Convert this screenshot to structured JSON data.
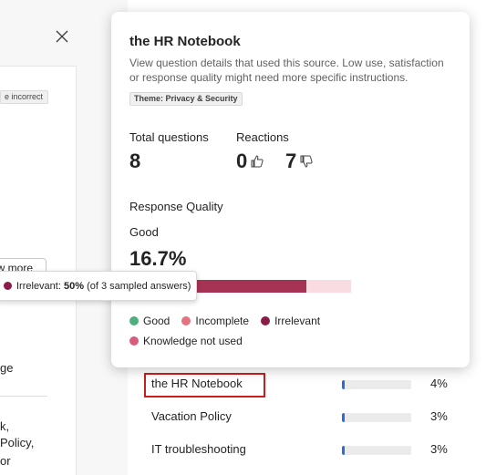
{
  "left_panel": {
    "tag_incorrect": "e incorrect",
    "view_more": "ew more",
    "text_1": "ge",
    "text_2": "k,",
    "text_3": "Policy,",
    "text_4": "or"
  },
  "tooltip": {
    "label": "Irrelevant:",
    "value": "50%",
    "detail": "(of 3 sampled answers)",
    "dot_color": "#8a1c47"
  },
  "card": {
    "title": "the HR Notebook",
    "description": "View question details that used this source. Low use, satisfaction or response quality might need more specific instructions.",
    "theme_badge": "Theme: Privacy & Security",
    "total_questions_label": "Total questions",
    "total_questions_value": "8",
    "reactions_label": "Reactions",
    "thumbs_up_count": "0",
    "thumbs_down_count": "7",
    "icons": [
      "thumbs-up-icon",
      "thumbs-down-icon"
    ],
    "response_quality_label": "Response Quality",
    "quality_category": "Good",
    "quality_percent": "16.7%",
    "quality_bar": [
      {
        "name": "Good",
        "fraction": 0.167,
        "color": "#f2b8c4"
      },
      {
        "name": "Irrelevant",
        "fraction": 0.5,
        "color": "#a63354"
      },
      {
        "name": "Knowledge not used",
        "fraction": 0.167,
        "color": "#f9dbe2"
      }
    ],
    "legend": [
      {
        "label": "Good",
        "color": "#4caf7d"
      },
      {
        "label": "Incomplete",
        "color": "#e5737f"
      },
      {
        "label": "Irrelevant",
        "color": "#8a1c47"
      },
      {
        "label": "Knowledge not used",
        "color": "#d95c7c"
      }
    ]
  },
  "sources": [
    {
      "name": "the HR Notebook",
      "percent": "4%",
      "fraction": 0.04
    },
    {
      "name": "Vacation Policy",
      "percent": "3%",
      "fraction": 0.03
    },
    {
      "name": "IT troubleshooting",
      "percent": "3%",
      "fraction": 0.03
    }
  ]
}
